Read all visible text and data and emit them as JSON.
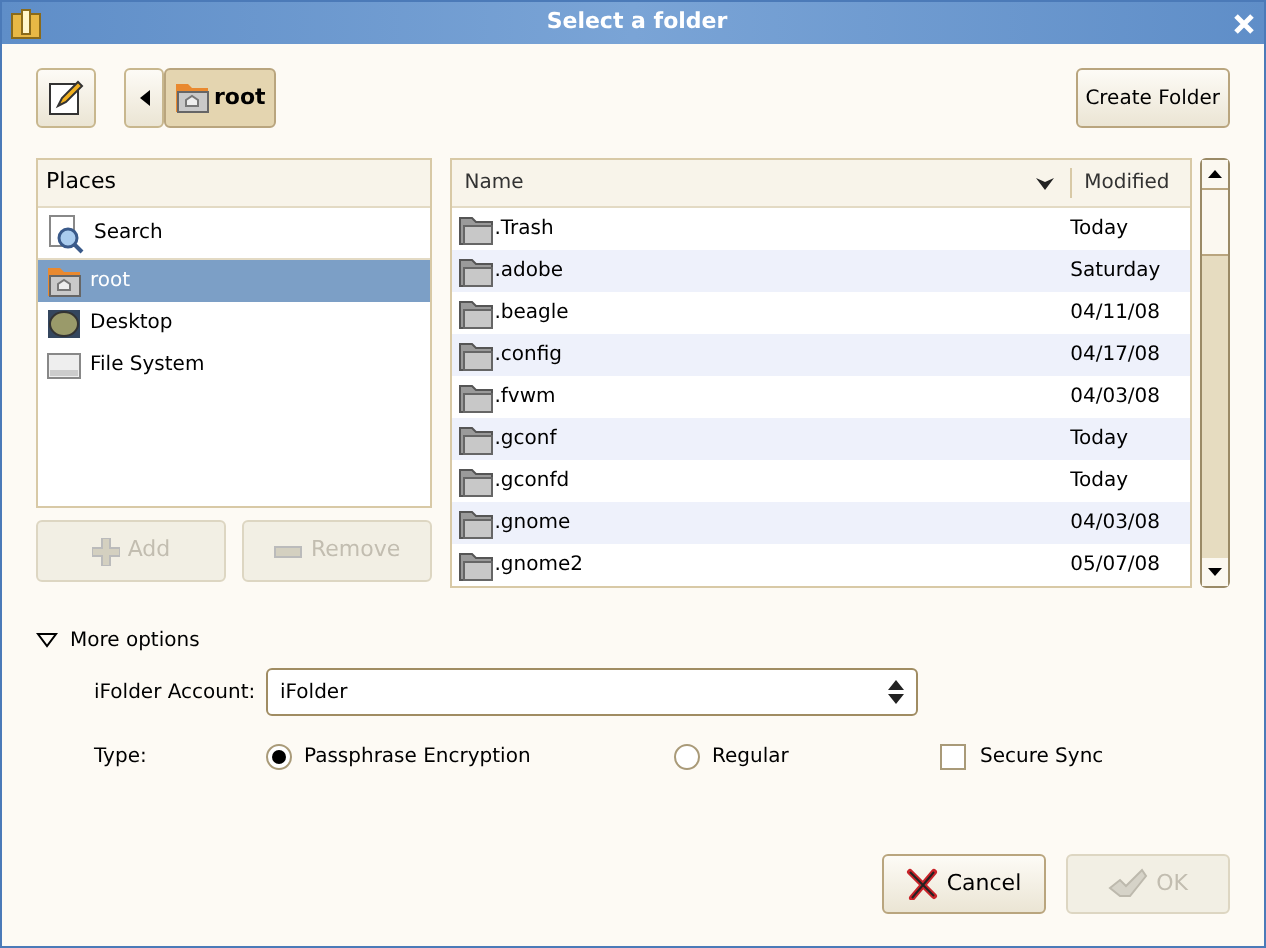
{
  "window": {
    "title": "Select a folder"
  },
  "toolbar": {
    "path": [
      {
        "label": "root",
        "selected": true
      }
    ],
    "create_button": "Create Folder"
  },
  "places": {
    "heading": "Places",
    "items": [
      {
        "kind": "search",
        "label": "Search",
        "selected": false
      },
      {
        "kind": "home",
        "label": "root",
        "selected": true
      },
      {
        "kind": "desktop",
        "label": "Desktop",
        "selected": false
      },
      {
        "kind": "drive",
        "label": "File System",
        "selected": false
      }
    ],
    "buttons": [
      {
        "kind": "add",
        "label": "Add",
        "disabled": true
      },
      {
        "kind": "remove",
        "label": "Remove",
        "disabled": true
      }
    ]
  },
  "files": {
    "columns": [
      "Name",
      "Modified"
    ],
    "rows": [
      {
        "name": ".Trash",
        "modified": "Today"
      },
      {
        "name": ".adobe",
        "modified": "Saturday"
      },
      {
        "name": ".beagle",
        "modified": "04/11/08"
      },
      {
        "name": ".config",
        "modified": "04/17/08"
      },
      {
        "name": ".fvwm",
        "modified": "04/03/08"
      },
      {
        "name": ".gconf",
        "modified": "Today"
      },
      {
        "name": ".gconfd",
        "modified": "Today"
      },
      {
        "name": ".gnome",
        "modified": "04/03/08"
      },
      {
        "name": ".gnome2",
        "modified": "05/07/08"
      }
    ]
  },
  "options": {
    "label": "More options",
    "expanded": true,
    "account_label": "iFolder Account:",
    "account_value": "iFolder",
    "type_label": "Type:",
    "types": [
      {
        "label": "Passphrase Encryption",
        "selected": true
      },
      {
        "label": "Regular",
        "selected": false
      }
    ],
    "secure_sync": {
      "label": "Secure Sync",
      "checked": false
    }
  },
  "buttons": [
    {
      "kind": "cancel",
      "label": "Cancel",
      "disabled": false
    },
    {
      "kind": "ok",
      "label": "OK",
      "disabled": true
    }
  ]
}
